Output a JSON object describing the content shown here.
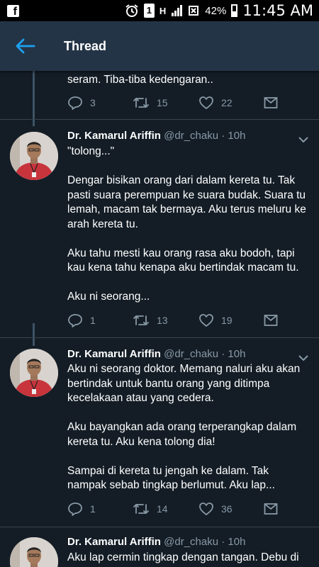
{
  "status_bar": {
    "battery": "42%",
    "time": "11:45 AM",
    "sim": "1",
    "network": "H"
  },
  "app_bar": {
    "title": "Thread"
  },
  "tweets": [
    {
      "text": "seram. Tiba-tiba kedengaran..",
      "replies": "3",
      "retweets": "15",
      "likes": "22"
    },
    {
      "name": "Dr. Kamarul Ariffin",
      "handle": "@dr_chaku · 10h",
      "text": "\"tolong...\"\n\nDengar bisikan orang dari dalam kereta tu. Tak pasti suara perempuan ke suara budak. Suara tu lemah, macam tak bermaya. Aku terus meluru ke arah kereta tu.\n\nAku tahu mesti kau orang rasa aku bodoh, tapi kau kena tahu kenapa aku bertindak macam tu.\n\nAku ni seorang...",
      "replies": "1",
      "retweets": "13",
      "likes": "19"
    },
    {
      "name": "Dr. Kamarul Ariffin",
      "handle": "@dr_chaku · 10h",
      "text": "Aku ni seorang doktor. Memang naluri aku akan bertindak untuk bantu orang yang ditimpa kecelakaan atau yang cedera.\n\nAku bayangkan ada orang terperangkap dalam kereta tu. Aku kena tolong dia!\n\nSampai di kereta tu jengah ke dalam. Tak nampak sebab tingkap berlumut. Aku lap...",
      "replies": "1",
      "retweets": "14",
      "likes": "36"
    },
    {
      "name": "Dr. Kamarul Ariffin",
      "handle": "@dr_chaku · 10h",
      "text": "Aku lap cermin tingkap dengan tangan. Debu di"
    }
  ]
}
